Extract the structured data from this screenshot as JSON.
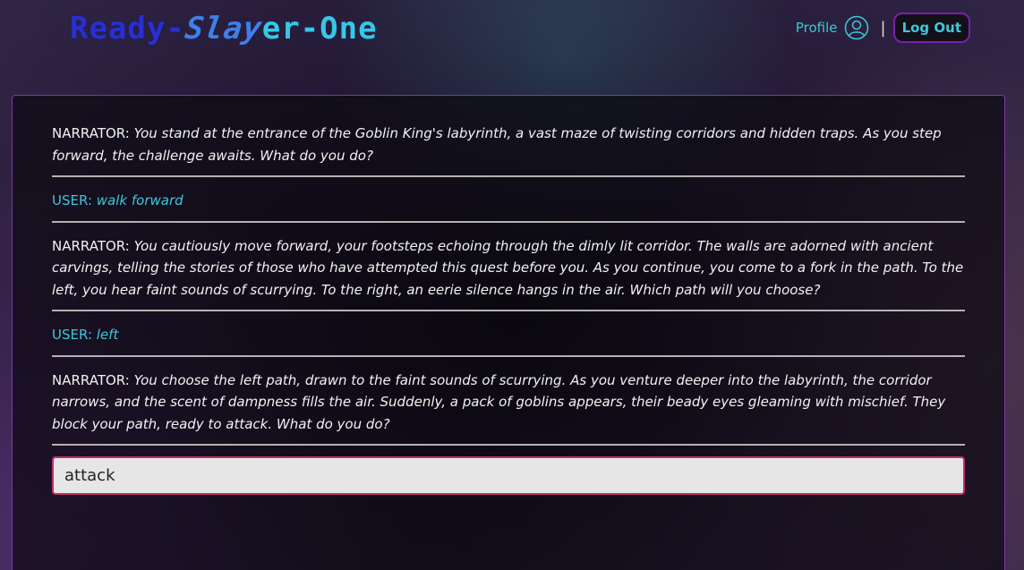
{
  "header": {
    "logo_part1": "Ready-",
    "logo_part2": "Slay",
    "logo_part3": "er-One",
    "profile_label": "Profile",
    "separator": "|",
    "logout_label": "Log Out"
  },
  "chat": {
    "messages": [
      {
        "speaker": "NARRATOR:",
        "text": "You stand at the entrance of the Goblin King's labyrinth, a vast maze of twisting corridors and hidden traps. As you step forward, the challenge awaits. What do you do?"
      },
      {
        "speaker": "USER:",
        "text": "walk forward"
      },
      {
        "speaker": "NARRATOR:",
        "text": "You cautiously move forward, your footsteps echoing through the dimly lit corridor. The walls are adorned with ancient carvings, telling the stories of those who have attempted this quest before you. As you continue, you come to a fork in the path. To the left, you hear faint sounds of scurrying. To the right, an eerie silence hangs in the air. Which path will you choose?"
      },
      {
        "speaker": "USER:",
        "text": "left"
      },
      {
        "speaker": "NARRATOR:",
        "text": "You choose the left path, drawn to the faint sounds of scurrying. As you venture deeper into the labyrinth, the corridor narrows, and the scent of dampness fills the air. Suddenly, a pack of goblins appears, their beady eyes gleaming with mischief. They block your path, ready to attack. What do you do?"
      }
    ],
    "input_value": "attack"
  },
  "colors": {
    "accent": "#3ec7d9",
    "border": "#7a3aa8",
    "input_border": "#c0306a"
  }
}
